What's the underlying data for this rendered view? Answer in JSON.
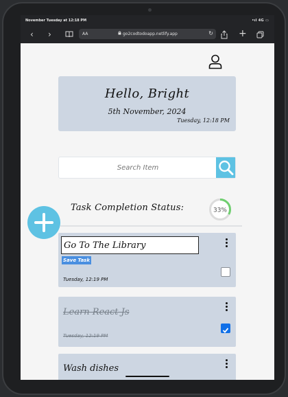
{
  "browser": {
    "status_left": "November Tuesday at 12:18 PM",
    "status_right": "•ıl 4G ▭",
    "aa_label": "AA",
    "url": "go2codtodoapp.netlify.app",
    "icons": [
      "back-icon",
      "forward-icon",
      "book-icon",
      "lock-icon",
      "reload-icon",
      "share-icon",
      "new-tab-icon",
      "tabs-icon"
    ]
  },
  "header": {
    "greeting": "Hello, Bright",
    "date": "5th November, 2024",
    "datetime": "Tuesday, 12:18 PM"
  },
  "search": {
    "placeholder": "Search Item"
  },
  "status": {
    "label": "Task Completion Status:",
    "percent_text": "33%",
    "percent_value": 33
  },
  "tasks": [
    {
      "title": "Go To The Library",
      "time": "Tuesday, 12:19 PM",
      "save_label": "Save Task",
      "editing": true,
      "done": false
    },
    {
      "title": "Learn React Js",
      "time": "Tuesday, 12:19 PM",
      "editing": false,
      "done": true
    },
    {
      "title": "Wash dishes",
      "editing": false,
      "done": false
    }
  ],
  "colors": {
    "accent": "#5ec2e3",
    "card": "#cdd6e2",
    "checkbox_checked": "#0f6fe8",
    "save_button": "#4a8fe0"
  }
}
